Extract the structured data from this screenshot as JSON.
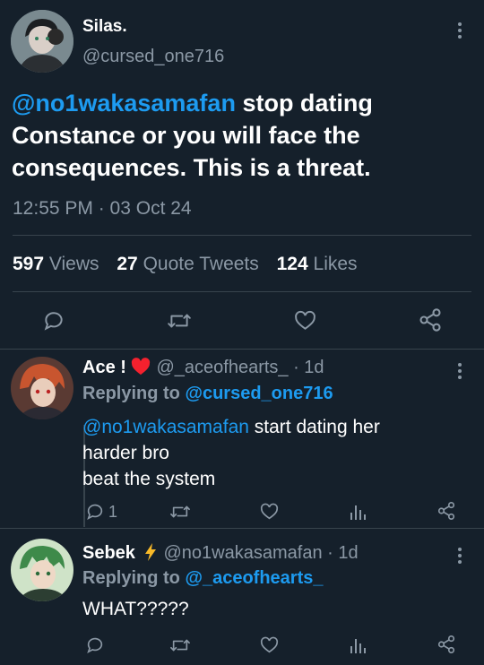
{
  "main_tweet": {
    "display_name": "Silas.",
    "handle": "@cursed_one716",
    "mention": "@no1wakasamafan",
    "text_line1": " stop dating",
    "text_line2": "Constance or you will face the",
    "text_line3": "consequences. This is a threat.",
    "timestamp": "12:55 PM · 03 Oct 24",
    "stats": {
      "views_count": "597",
      "views_label": "Views",
      "quotes_count": "27",
      "quotes_label": "Quote Tweets",
      "likes_count": "124",
      "likes_label": "Likes"
    }
  },
  "replies": [
    {
      "display_name": "Ace ! ",
      "emoji": "❤️",
      "handle": "@_aceofhearts_",
      "time": " · 1d",
      "replying_label": "Replying to ",
      "replying_to": "@cursed_one716",
      "mention": "@no1wakasamafan",
      "text_line1": " start dating her",
      "text_line2": "harder bro",
      "text_line3": "beat the system",
      "reply_count": "1"
    },
    {
      "display_name": "Sebek",
      "emoji": "⚡",
      "handle": "@no1wakasamafan",
      "time": " · 1d",
      "replying_label": "Replying to ",
      "replying_to": "@_aceofhearts_",
      "text_line1": "WHAT?????"
    }
  ],
  "icons": [
    "more-vertical-icon",
    "reply-icon",
    "retweet-icon",
    "like-icon",
    "share-icon",
    "views-icon",
    "lightning-icon",
    "heart-emoji-icon"
  ],
  "colors": {
    "background": "#15202b",
    "text": "#ffffff",
    "muted": "#8b98a5",
    "link": "#1d9bf0",
    "divider": "#38444d",
    "emoji_red": "#f4212e",
    "emoji_yellow": "#f7b928"
  }
}
